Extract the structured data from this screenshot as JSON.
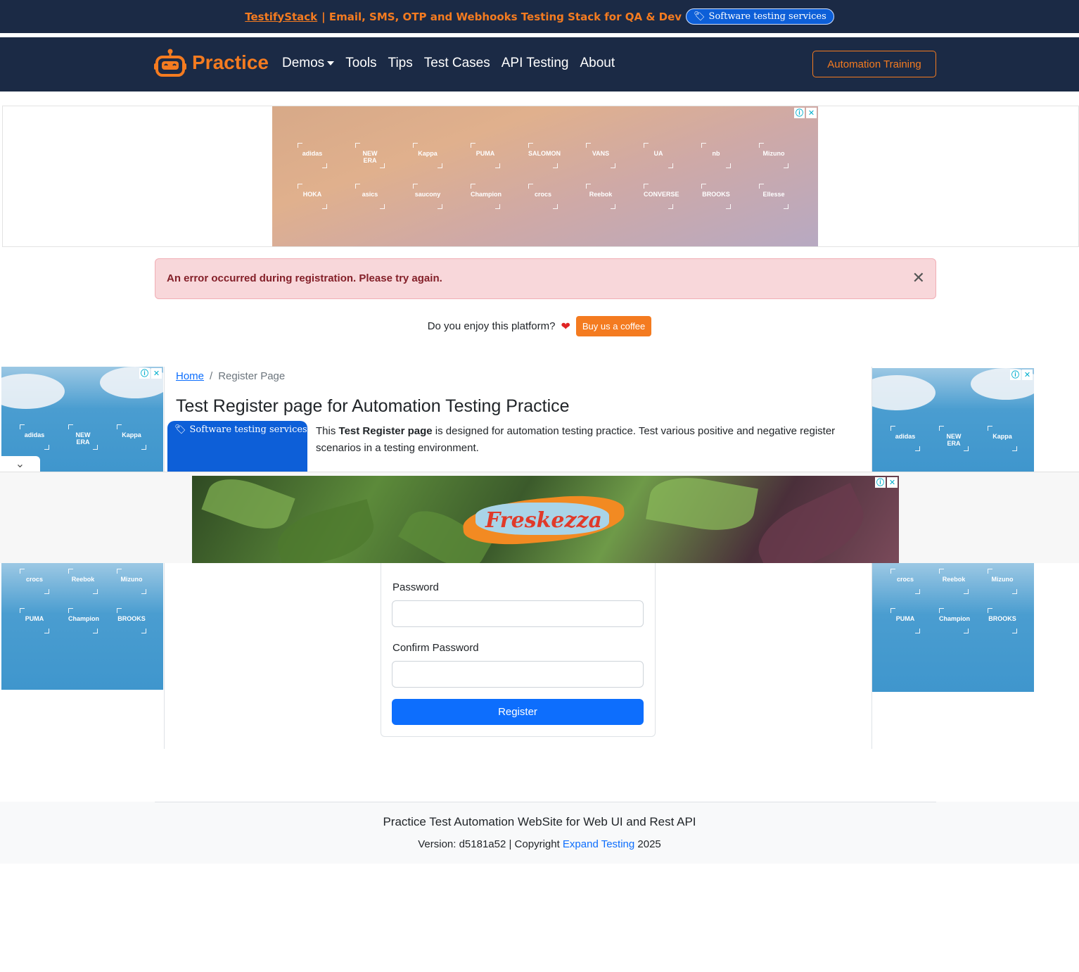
{
  "top_banner": {
    "brand": "TestifyStack",
    "text": " | Email, SMS, OTP and Webhooks Testing Stack for QA & Dev",
    "pill_label": "Software testing services"
  },
  "navbar": {
    "logo_text": "Practice",
    "links": [
      {
        "label": "Demos"
      },
      {
        "label": "Tools"
      },
      {
        "label": "Tips"
      },
      {
        "label": "Test Cases"
      },
      {
        "label": "API Testing"
      },
      {
        "label": "About"
      }
    ],
    "cta_label": "Automation Training"
  },
  "top_ad": {
    "row1": [
      "adidas",
      "NEW ERA",
      "Kappa",
      "PUMA",
      "SALOMON",
      "VANS",
      "UA",
      "nb",
      "Mizuno"
    ],
    "row2": [
      "HOKA",
      "asics",
      "saucony",
      "Champion",
      "crocs",
      "Reebok",
      "CONVERSE",
      "BROOKS",
      "Ellesse"
    ]
  },
  "alert": {
    "message": "An error occurred during registration. Please try again.",
    "close_glyph": "✕"
  },
  "coffee": {
    "question": "Do you enjoy this platform?",
    "heart": "❤",
    "button_label": "Buy us a coffee"
  },
  "side_ads": {
    "top_logos": [
      "adidas",
      "NEW ERA",
      "Kappa"
    ],
    "bottom_logos": [
      "crocs",
      "Reebok",
      "Mizuno",
      "PUMA",
      "Champion",
      "BROOKS"
    ]
  },
  "breadcrumb": {
    "home": "Home",
    "separator": "/",
    "current": "Register Page"
  },
  "page": {
    "title": "Test Register page for Automation Testing Practice",
    "pill_ad_label": "Software testing services",
    "intro_prefix": "This ",
    "intro_bold": "Test Register page",
    "intro_suffix": " is designed for automation testing practice. Test various positive and negative register scenarios in a testing environment."
  },
  "overlay_ad": {
    "brand": "Freskezza"
  },
  "form": {
    "password_label": "Password",
    "password_value": "",
    "confirm_label": "Confirm Password",
    "confirm_value": "",
    "submit_label": "Register"
  },
  "footer": {
    "title": "Practice Test Automation WebSite for Web UI and Rest API",
    "version_prefix": "Version: d5181a52 | Copyright ",
    "link_text": "Expand Testing",
    "year": " 2025"
  },
  "colors": {
    "navy": "#1b2a45",
    "orange": "#f47b20",
    "primary": "#0d6efd",
    "alert_bg": "#f8d7da",
    "alert_text": "#842029"
  }
}
